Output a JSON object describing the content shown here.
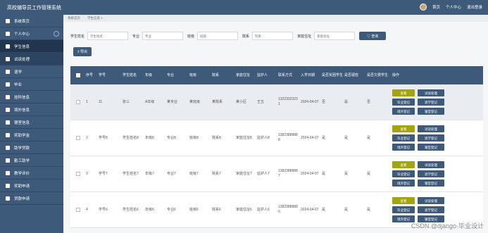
{
  "header": {
    "app_title": "高校辅导员工作管理系统",
    "links": [
      "首页",
      "个人中心",
      "退出登录"
    ]
  },
  "sidebar": {
    "items": [
      {
        "label": "系统首页"
      },
      {
        "label": "个人中心"
      },
      {
        "label": "学生信息"
      },
      {
        "label": "试读处理"
      },
      {
        "label": "退学"
      },
      {
        "label": "毕业"
      },
      {
        "label": "挂科信息"
      },
      {
        "label": "境外信息"
      },
      {
        "label": "寝室信息"
      },
      {
        "label": "奖助学金"
      },
      {
        "label": "助学贷款"
      },
      {
        "label": "勤工助学"
      },
      {
        "label": "教学评价"
      },
      {
        "label": "奖助申请"
      },
      {
        "label": "贷款申请"
      }
    ]
  },
  "breadcrumb": {
    "home": "系统首页",
    "current": "学生信息 >"
  },
  "filters": [
    {
      "label": "学生姓名",
      "placeholder": "学生姓名"
    },
    {
      "label": "专业",
      "placeholder": "专业"
    },
    {
      "label": "班级",
      "placeholder": "班级"
    },
    {
      "label": "院系",
      "placeholder": "院系"
    },
    {
      "label": "家庭住址",
      "placeholder": "家庭住址"
    }
  ],
  "search_label": "♡ 查询",
  "export_label": "± 导出",
  "table": {
    "columns": [
      "序号",
      "学号",
      "学生姓名",
      "年级",
      "专业",
      "班级",
      "院系",
      "家庭住址",
      "监护人",
      "联系方式",
      "入学日期",
      "是否贫困学生",
      "是否寝检",
      "是否欠费学生",
      "操作"
    ],
    "rows": [
      {
        "idx": "1",
        "no": "11",
        "name": "张三",
        "grade": "A年级",
        "major": "某专业",
        "cls": "某班级",
        "dept": "某院系",
        "addr": "某小区",
        "guard": "王五",
        "tel": "13223323231",
        "date": "2024-04-07",
        "poor": "否",
        "dorm": "是",
        "debt": "否"
      },
      {
        "idx": "2",
        "no": "学号8",
        "name": "学生姓名8",
        "grade": "年级8",
        "major": "专业8",
        "cls": "班级8",
        "dept": "院系8",
        "addr": "家庭住址8",
        "guard": "监护人8",
        "tel": "13823888888",
        "date": "2024-04-07",
        "poor": "是",
        "dorm": "是",
        "debt": "是"
      },
      {
        "idx": "3",
        "no": "学号7",
        "name": "学生姓名7",
        "grade": "年级7",
        "major": "专业7",
        "cls": "班级7",
        "dept": "院系7",
        "addr": "家庭住址7",
        "guard": "监护人7",
        "tel": "13823888887",
        "date": "2024-04-07",
        "poor": "是",
        "dorm": "是",
        "debt": "是"
      },
      {
        "idx": "4",
        "no": "学号6",
        "name": "学生姓名6",
        "grade": "年级6",
        "major": "专业6",
        "cls": "班级6",
        "dept": "院系6",
        "addr": "家庭住址6",
        "guard": "监护人6",
        "tel": "13823888886",
        "date": "2024-04-07",
        "poor": "是",
        "dorm": "是",
        "debt": "是"
      }
    ],
    "op_labels": {
      "view": "查看",
      "trial": "试读处理",
      "grad": "毕业登记",
      "drop": "退学登记",
      "abroad": "境外登记",
      "dormreg": "寝室登记"
    }
  },
  "watermark": "CSDN @django-毕业设计"
}
